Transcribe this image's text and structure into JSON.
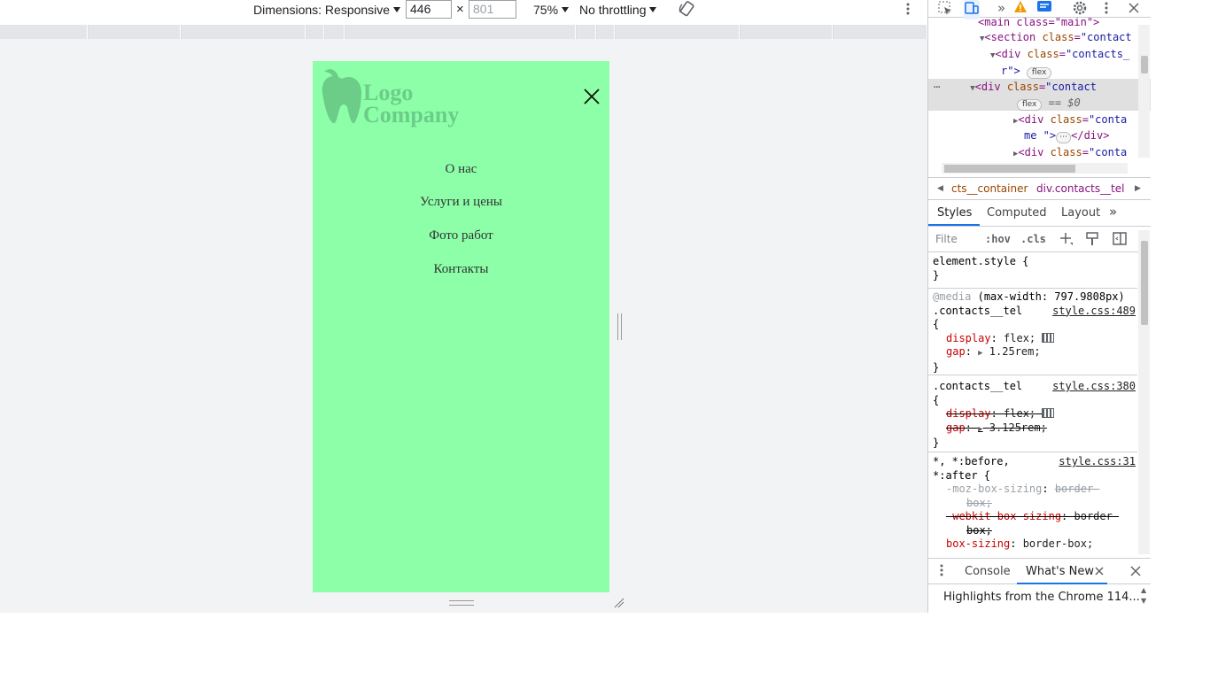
{
  "device_toolbar": {
    "dimensions_label": "Dimensions: Responsive",
    "width_value": "446",
    "times": "×",
    "height_placeholder": "801",
    "zoom": "75%",
    "throttling": "No throttling"
  },
  "page": {
    "logo_line1": "Logo",
    "logo_line2": "Company",
    "nav": [
      "О нас",
      "Услуги и цены",
      "Фото работ",
      "Контакты"
    ],
    "bg_color": "#8cffa8",
    "logo_color": "#6bcd88"
  },
  "devtools": {
    "dom": {
      "line0": "<main class=\"main\">",
      "line1_tag": "section",
      "line1_attr": "class",
      "line1_val": "\"contact",
      "line2_tag": "div",
      "line2_attr": "class",
      "line2_val": "\"contacts_",
      "line3": "r\">",
      "line3_badge": "flex",
      "line4_tag": "div",
      "line4_attr": "class",
      "line4_val": "\"contact",
      "line5_badge": "flex",
      "line5_eq": "== $0",
      "line6_tag": "div",
      "line6_attr": "class",
      "line6_val": "\"conta",
      "line7": "me \">",
      "line7_ellipsis": "⋯",
      "line7_close": "</div>",
      "line8_tag": "div",
      "line8_attr": "class",
      "line8_val": "\"conta",
      "ellipsis_marker": "⋯"
    },
    "breadcrumbs": [
      "cts__container",
      "div.contacts__tel"
    ],
    "tabs": [
      "Styles",
      "Computed",
      "Layout"
    ],
    "more_tabs": "»",
    "filter_placeholder": "Filte",
    "hov": ":hov",
    "cls": ".cls",
    "rules": {
      "element_style": "element.style {",
      "close": "}",
      "media": "@media",
      "media_query": "(max-width: 797.9808px)",
      "selector": ".contacts__tel",
      "open": "{",
      "src1": "style.css:489",
      "src2": "style.css:380",
      "src3": "style.css:31",
      "display": "display",
      "flex": "flex;",
      "gap": "gap",
      "gap1": "1.25rem;",
      "gap2": "3.125rem;",
      "universal1": "*, *:before,",
      "universal2": "*:after {",
      "moz": "-moz-box-sizing",
      "webkit": "-webkit-box-sizing",
      "bb": "border-",
      "box": "box;",
      "box_sizing": "box-sizing",
      "border_box": "border-box;"
    },
    "drawer": {
      "console": "Console",
      "whats_new": "What's New",
      "highlights": "Highlights from the Chrome 114..."
    }
  }
}
